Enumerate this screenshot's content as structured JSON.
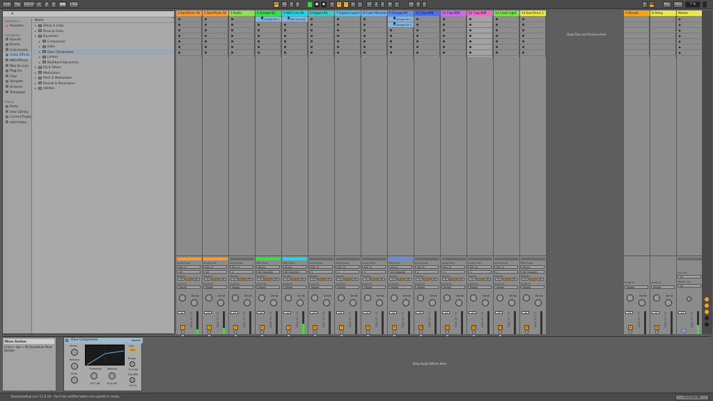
{
  "transport": {
    "link": "Link",
    "tap": "Tap",
    "tempo": "120.00",
    "sig_num": "4",
    "sig_den": "4",
    "metro": "●●",
    "quant": "1 Bar",
    "pos": [
      "26",
      "3",
      "4"
    ],
    "loop_start": [
      "17",
      "1",
      "1"
    ],
    "loop_len": [
      "16",
      "0",
      "0"
    ],
    "key": "Key",
    "midi": "MIDI",
    "cpu": "7 %"
  },
  "browser": {
    "search_placeholder": "A",
    "collections_header": "Collections",
    "favorites": "Favorites",
    "categories_header": "Categories",
    "categories": [
      "Sounds",
      "Drums",
      "Instruments",
      "Audio Effects",
      "MIDI Effects",
      "Max for Live",
      "Plug-Ins",
      "Clips",
      "Samples",
      "Grooves",
      "Templates"
    ],
    "places_header": "Places",
    "places": [
      "Packs",
      "User Library",
      "Current Project",
      "Add Folder..."
    ],
    "name_header": "Name",
    "items": [
      {
        "label": "Delay & Loop",
        "depth": 0,
        "open": false
      },
      {
        "label": "Drive & Color",
        "depth": 0,
        "open": false
      },
      {
        "label": "Dynamics",
        "depth": 0,
        "open": true
      },
      {
        "label": "Compressor",
        "depth": 1,
        "open": false
      },
      {
        "label": "Gate",
        "depth": 1,
        "open": false
      },
      {
        "label": "Glue Compressor",
        "depth": 1,
        "open": false
      },
      {
        "label": "Limiter",
        "depth": 1,
        "open": false
      },
      {
        "label": "Multiband Dynamics",
        "depth": 1,
        "open": false
      },
      {
        "label": "EQ & Filters",
        "depth": 0,
        "open": false
      },
      {
        "label": "Modulators",
        "depth": 0,
        "open": false
      },
      {
        "label": "Pitch & Modulation",
        "depth": 0,
        "open": false
      },
      {
        "label": "Reverb & Resonance",
        "depth": 0,
        "open": false
      },
      {
        "label": "Utilities",
        "depth": 0,
        "open": false
      }
    ]
  },
  "tracks": [
    {
      "name": "1 Sacrificios 10",
      "color": "#f39c3a",
      "num": "1",
      "in_label": "Audio From",
      "in": "Ext. In",
      "ch": "1/2",
      "clips": [],
      "level": 0.22,
      "rec": false
    },
    {
      "name": "2 Sacrificios 10",
      "color": "#f39c3a",
      "num": "2",
      "in_label": "Audio From",
      "in": "Ext. In",
      "ch": "1/2",
      "clips": [],
      "level": 0.28,
      "rec": false
    },
    {
      "name": "3 Audio",
      "color": "#8ee052",
      "num": "3",
      "in_label": "Audio From",
      "in": "Ext. In",
      "ch": "1",
      "clips": [],
      "level": 0.0,
      "rec": false
    },
    {
      "name": "4 Garage Kit",
      "color": "#39e04a",
      "num": "4",
      "in_label": "MIDI From",
      "in": "All Ins",
      "ch": "All Channels",
      "clips": [
        "4-Garage Kit 1"
      ],
      "level": 0.0,
      "rec": false
    },
    {
      "name": "5 808 Core Kit",
      "color": "#21d7e3",
      "num": "5",
      "in_label": "MIDI From",
      "in": "All Ins",
      "ch": "All Channels",
      "clips": [
        "5-808 Core Kit"
      ],
      "level": 0.45,
      "rec": false
    },
    {
      "name": "6 Impact Kit",
      "color": "#3bc9c9",
      "num": "6",
      "in_label": "Audio From",
      "in": "Ext. In",
      "ch": "1",
      "clips": [],
      "level": 0.0,
      "rec": false
    },
    {
      "name": "7 Impact Layers",
      "color": "#5dbde8",
      "num": "7",
      "in_label": "Audio From",
      "in": "Ext. In",
      "ch": "1",
      "clips": [],
      "level": 0.0,
      "rec": false
    },
    {
      "name": "8 Crash Mansion",
      "color": "#6fb0f0",
      "num": "8",
      "in_label": "Audio From",
      "in": "Ext. In",
      "ch": "1",
      "clips": [],
      "level": 0.0,
      "rec": false
    },
    {
      "name": "9 Garage Kit",
      "color": "#5d8ee8",
      "num": "9",
      "in_label": "MIDI From",
      "in": "All Ins",
      "ch": "All Channels",
      "clips": [
        "9-Garage Kit 1",
        "9-Garage Kit 2"
      ],
      "level": 0.0,
      "rec": false
    },
    {
      "name": "10 Clap 808",
      "color": "#4c6de8",
      "num": "10",
      "in_label": "Audio From",
      "in": "Ext. In",
      "ch": "1",
      "clips": [],
      "level": 0.0,
      "rec": false
    },
    {
      "name": "11 Clap 808",
      "color": "#c46ee8",
      "num": "11",
      "in_label": "Audio From",
      "in": "Ext. In",
      "ch": "1",
      "clips": [],
      "level": 0.0,
      "rec": false
    },
    {
      "name": "12 Clap 808",
      "color": "#e56dc8",
      "num": "12",
      "in_label": "Audio From",
      "in": "Ext. In",
      "ch": "1",
      "clips": [],
      "level": 0.0,
      "rec": false
    },
    {
      "name": "13 Crash Light",
      "color": "#7ee04a",
      "num": "13",
      "in_label": "Audio From",
      "in": "Ext. In",
      "ch": "1",
      "clips": [],
      "level": 0.0,
      "rec": false
    },
    {
      "name": "14 Sacrificios 1",
      "color": "#e8e84a",
      "num": "14",
      "in_label": "MIDI From",
      "in": "All Ins",
      "ch": "All Channels",
      "clips": [],
      "level": 0.0,
      "rec": true
    }
  ],
  "common": {
    "monitor_label": "Monitor",
    "mon": [
      "In",
      "Auto",
      "Off"
    ],
    "out_label": "Audio To",
    "out": "Master",
    "sends": "Sends",
    "vol": "-inf",
    "ticks": [
      "12",
      "0",
      "12",
      "24",
      "36",
      "48",
      "60"
    ]
  },
  "drop_tracks": "Drop Files and Devices Here",
  "returns": [
    {
      "name": "A Reverb",
      "color": "#f3a521",
      "letter": "A",
      "out": "Master"
    },
    {
      "name": "B Delay",
      "color": "#e8e84a",
      "letter": "B",
      "out": "Master"
    }
  ],
  "master": {
    "name": "Master",
    "color": "#e8e84a",
    "cue_label": "Cue Out",
    "cue": "1/2",
    "out_label": "Master Out",
    "out": "1/2"
  },
  "info": {
    "title": "Mixer Section",
    "text": "[Cmd + Opt + M] Show/Hide Mixer Section"
  },
  "device": {
    "name": "Glue Compressor",
    "right": "ogi/Adv",
    "attack_label": "Attack",
    "release_label": "Release",
    "ratio_label": "Ratio",
    "threshold_label": "Threshold",
    "threshold": "-16.2 dB",
    "makeup_label": "Makeup",
    "makeup": "6.00 dB",
    "clip": "Clip",
    "soft": "Soft",
    "range_label": "Range",
    "range": "70.0 dB",
    "drywet_label": "Dry/Wet",
    "drywet": "100 %"
  },
  "drop_effects": "Drop Audio Effects Here",
  "status": {
    "message": "Downloading Live 11.0.10 - You'll be notified when the update is ready",
    "right": "13-Crash Mil"
  }
}
